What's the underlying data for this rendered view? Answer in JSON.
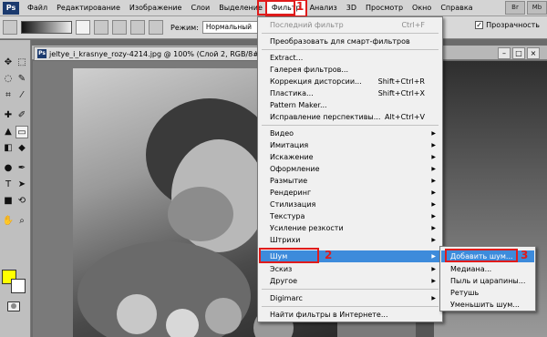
{
  "menubar": {
    "logo": "Ps",
    "items": [
      "Файл",
      "Редактирование",
      "Изображение",
      "Слои",
      "Выделение",
      "Фильтр",
      "Анализ",
      "3D",
      "Просмотр",
      "Окно",
      "Справка"
    ],
    "right_buttons": [
      "Br",
      "Mb"
    ]
  },
  "options": {
    "mode_label": "Режим:",
    "mode_value": "Нормальный",
    "transparency_label": "Прозрачность",
    "transparency_checked": true
  },
  "document": {
    "tab_title": "jeltye_i_krasnye_rozy-4214.jpg @ 100% (Слой 2, RGB/8#) ×"
  },
  "filter_menu": {
    "items": [
      {
        "label": "Последний фильтр",
        "shortcut": "Ctrl+F",
        "disabled": true
      },
      {
        "label": "Преобразовать для смарт-фильтров"
      },
      {
        "label": "Extract..."
      },
      {
        "label": "Галерея фильтров..."
      },
      {
        "label": "Коррекция дисторсии...",
        "shortcut": "Shift+Ctrl+R"
      },
      {
        "label": "Пластика...",
        "shortcut": "Shift+Ctrl+X"
      },
      {
        "label": "Pattern Maker..."
      },
      {
        "label": "Исправление перспективы...",
        "shortcut": "Alt+Ctrl+V"
      },
      {
        "label": "Видео",
        "submenu": true
      },
      {
        "label": "Имитация",
        "submenu": true
      },
      {
        "label": "Искажение",
        "submenu": true
      },
      {
        "label": "Оформление",
        "submenu": true
      },
      {
        "label": "Размытие",
        "submenu": true
      },
      {
        "label": "Рендеринг",
        "submenu": true
      },
      {
        "label": "Стилизация",
        "submenu": true
      },
      {
        "label": "Текстура",
        "submenu": true
      },
      {
        "label": "Усиление резкости",
        "submenu": true
      },
      {
        "label": "Штрихи",
        "submenu": true
      },
      {
        "label": "Шум",
        "submenu": true,
        "highlighted": true
      },
      {
        "label": "Эскиз",
        "submenu": true
      },
      {
        "label": "Другое",
        "submenu": true
      },
      {
        "label": "Digimarc",
        "submenu": true
      },
      {
        "label": "Найти фильтры в Интернете..."
      }
    ]
  },
  "noise_submenu": {
    "items": [
      {
        "label": "Добавить шум...",
        "highlighted": true
      },
      {
        "label": "Медиана..."
      },
      {
        "label": "Пыль и царапины..."
      },
      {
        "label": "Ретушь"
      },
      {
        "label": "Уменьшить шум..."
      }
    ]
  },
  "annotations": {
    "step1": "1",
    "step2": "2",
    "step3": "3"
  },
  "colors": {
    "foreground": "#ffff00",
    "background": "#ffffff",
    "highlight": "#3d8bdb",
    "annotation": "#e01b1b"
  }
}
